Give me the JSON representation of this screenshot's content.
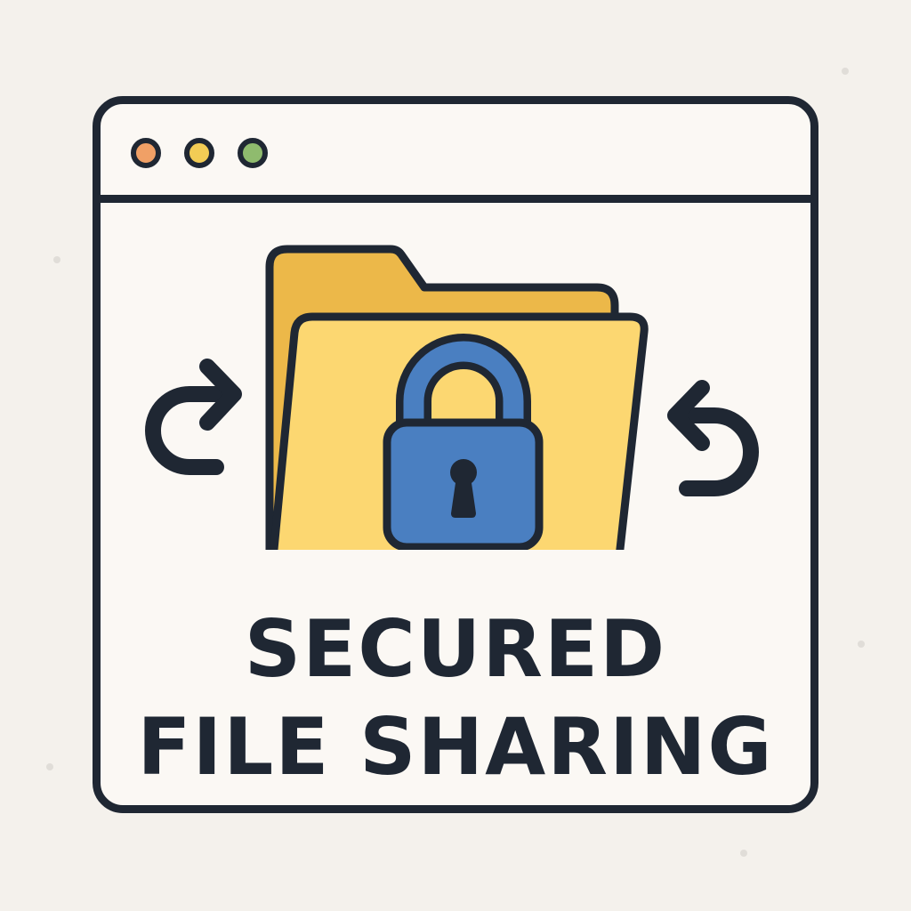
{
  "window": {
    "controls": [
      {
        "name": "close",
        "color": "#f0a066"
      },
      {
        "name": "minimize",
        "color": "#f2cc55"
      },
      {
        "name": "maximize",
        "color": "#8fbb6e"
      }
    ]
  },
  "illustration": {
    "icons": [
      "folder-icon",
      "padlock-icon",
      "keyhole-icon",
      "arrow-share-right-icon",
      "arrow-share-left-icon"
    ],
    "colors": {
      "outline": "#1f2733",
      "folder_back": "#ecb849",
      "folder_front": "#fcd771",
      "lock": "#4a7fc1",
      "window_bg": "#fbf8f4",
      "page_bg": "#f4f1ec"
    }
  },
  "headline": {
    "line1": "SECURED",
    "line2": "FILE SHARING"
  }
}
